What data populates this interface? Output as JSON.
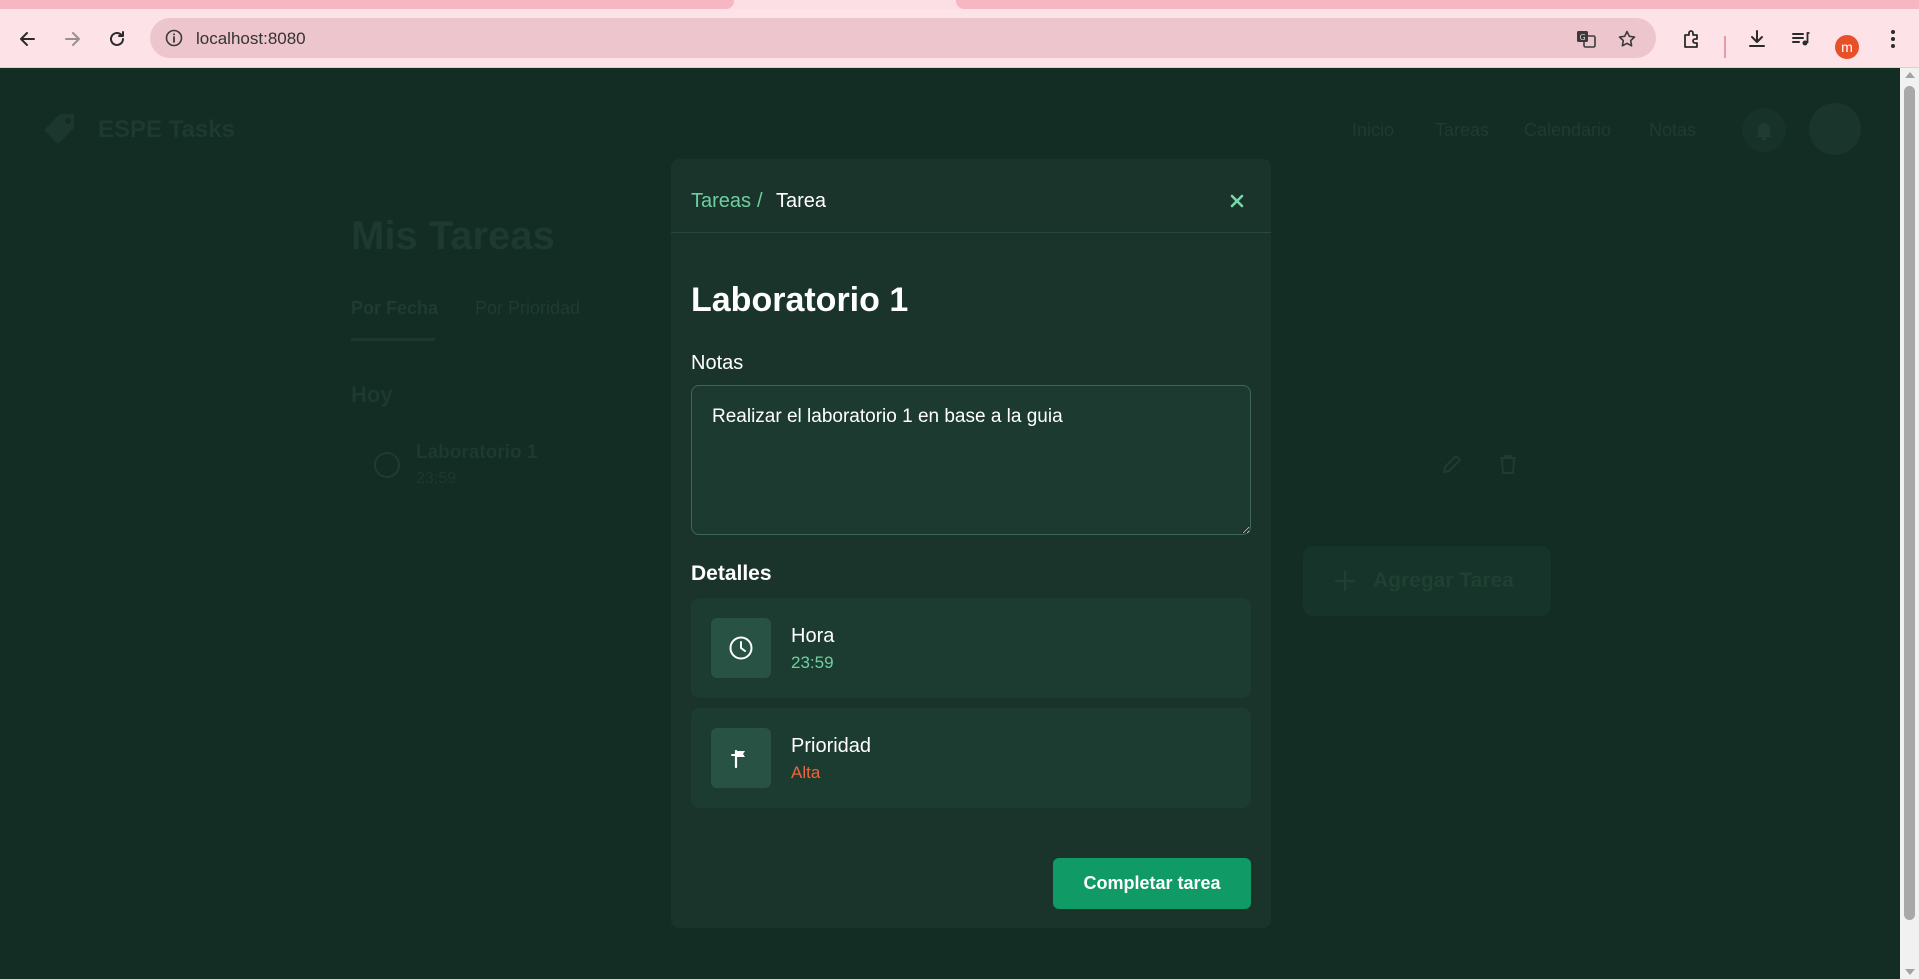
{
  "browser": {
    "url": "localhost:8080",
    "profile_initial": "m"
  },
  "app": {
    "brand": "ESPE Tasks",
    "nav": [
      "Inicio",
      "Tareas",
      "Calendario",
      "Notas"
    ],
    "page_title": "Mis Tareas",
    "tabs": [
      "Por Fecha",
      "Por Prioridad"
    ],
    "section": "Hoy",
    "task": {
      "title": "Laboratorio 1",
      "time": "23:59"
    },
    "add_button": "Agregar Tarea"
  },
  "modal": {
    "breadcrumb": {
      "parent": "Tareas",
      "separator": "/",
      "current": "Tarea"
    },
    "title": "Laboratorio 1",
    "notes_label": "Notas",
    "notes_value": "Realizar el laboratorio 1 en base a la guia",
    "details_label": "Detalles",
    "details": [
      {
        "icon": "clock-icon",
        "label": "Hora",
        "value": "23:59",
        "color": "#6fcf9f"
      },
      {
        "icon": "flag-icon",
        "label": "Prioridad",
        "value": "Alta",
        "color": "#f0643c"
      }
    ],
    "complete_button": "Completar tarea"
  },
  "colors": {
    "accent": "#0f9a66",
    "link": "#6fcf9f",
    "priority_high": "#f0643c",
    "modal_bg": "#1a342b",
    "page_bg": "#132c24"
  }
}
